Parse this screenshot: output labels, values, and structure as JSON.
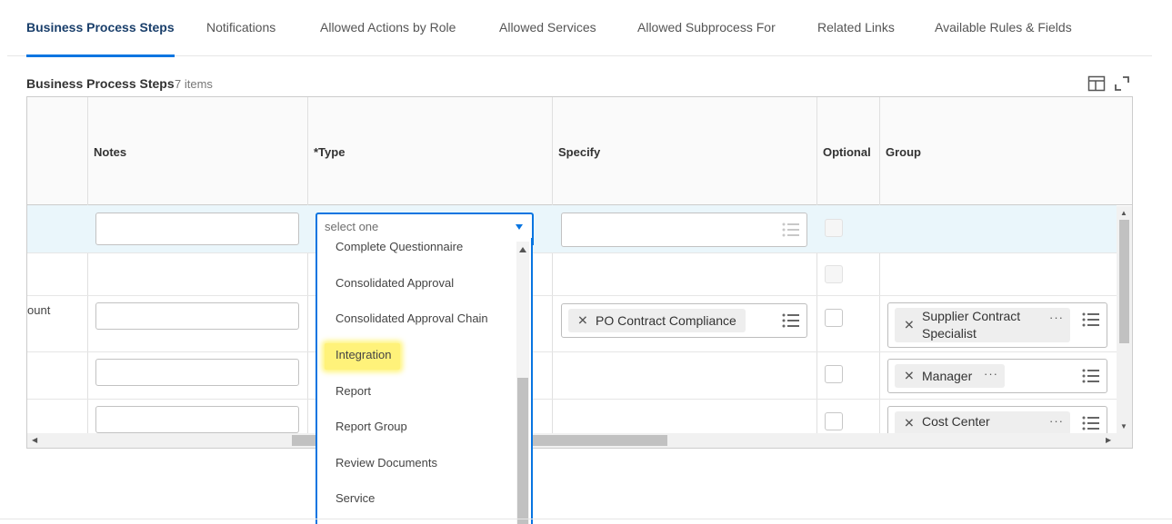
{
  "tabs": [
    {
      "label": "Business Process Steps",
      "active": true
    },
    {
      "label": "Notifications"
    },
    {
      "label": "Allowed Actions by Role"
    },
    {
      "label": "Allowed Services"
    },
    {
      "label": "Allowed Subprocess For"
    },
    {
      "label": "Related Links"
    },
    {
      "label": "Available Rules & Fields"
    }
  ],
  "grid": {
    "title": "Business Process Steps",
    "count": "7 items",
    "columns": {
      "notes": "Notes",
      "type": "*Type",
      "specify": "Specify",
      "optional": "Optional",
      "group": "Group"
    },
    "rows": [
      {
        "first_col_text": "",
        "specify_pills": [],
        "group_pills": []
      },
      {
        "first_col_text": "",
        "specify_pills": [],
        "group_pills": []
      },
      {
        "first_col_text": "ount",
        "specify_pills": [
          "PO Contract Compliance"
        ],
        "group_pills": [
          "Supplier Contract Specialist"
        ]
      },
      {
        "first_col_text": "",
        "specify_pills": [],
        "group_pills": [
          "Manager"
        ]
      },
      {
        "first_col_text": "",
        "specify_pills": [],
        "group_pills": [
          "Cost Center"
        ]
      }
    ]
  },
  "type_select": {
    "placeholder": "select one",
    "options": [
      "Complete Questionnaire",
      "Consolidated Approval",
      "Consolidated Approval Chain",
      "Integration",
      "Report",
      "Report Group",
      "Review Documents",
      "Service"
    ],
    "highlighted": "Integration",
    "highlight_color": "#fff27a"
  },
  "colors": {
    "accent": "#0875e1",
    "active_tab_text": "#1a3f6b",
    "selected_row": "#eaf6fb"
  },
  "icons": {
    "toolbar": [
      "table-layout-icon",
      "fullscreen-icon"
    ],
    "pill_remove": "close-icon",
    "pill_more": "more-icon",
    "prompt": "list-icon"
  }
}
